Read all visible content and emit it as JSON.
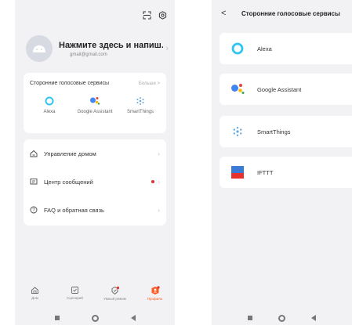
{
  "left": {
    "profile": {
      "name": "Нажмите здесь и напиш...",
      "email": "gmail@gmail.com"
    },
    "voice": {
      "title": "Сторонние голосовые сервисы",
      "more": "Больше >",
      "items": [
        {
          "label": "Alexa",
          "icon": "alexa-icon"
        },
        {
          "label": "Google Assistant",
          "icon": "google-assistant-icon"
        },
        {
          "label": "SmartThings",
          "icon": "smartthings-icon"
        }
      ]
    },
    "menu": [
      {
        "label": "Управление домом",
        "icon": "home-icon"
      },
      {
        "label": "Центр сообщений",
        "icon": "message-icon"
      },
      {
        "label": "FAQ и обратная связь",
        "icon": "help-icon"
      }
    ],
    "tabs": [
      {
        "label": "Дом",
        "icon": "home-tab-icon"
      },
      {
        "label": "Сценарий",
        "icon": "scenario-tab-icon"
      },
      {
        "label": "Умный режим",
        "icon": "smart-mode-tab-icon"
      },
      {
        "label": "Профиль",
        "icon": "profile-tab-icon"
      }
    ]
  },
  "right": {
    "title": "Сторонние голосовые сервисы",
    "back": "<",
    "services": [
      {
        "label": "Alexa",
        "icon": "alexa-icon"
      },
      {
        "label": "Google Assistant",
        "icon": "google-assistant-icon"
      },
      {
        "label": "SmartThings",
        "icon": "smartthings-icon"
      },
      {
        "label": "IFTTT",
        "icon": "ifttt-icon"
      }
    ]
  },
  "colors": {
    "accent": "#ff5a1f",
    "alexa": "#31c4f3",
    "badge": "#e8302d"
  }
}
